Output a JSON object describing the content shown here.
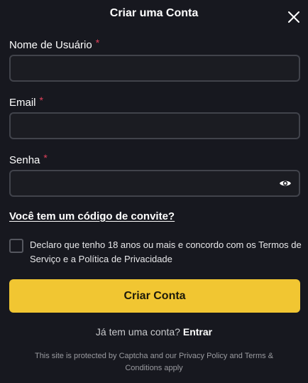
{
  "modal": {
    "title": "Criar uma Conta",
    "close_icon": "close-icon"
  },
  "fields": {
    "username": {
      "label": "Nome de Usuário",
      "required_mark": "*",
      "value": "",
      "placeholder": ""
    },
    "email": {
      "label": "Email",
      "required_mark": "*",
      "value": "",
      "placeholder": ""
    },
    "password": {
      "label": "Senha",
      "required_mark": "*",
      "value": "",
      "placeholder": "",
      "toggle_icon": "eye-icon"
    }
  },
  "invite": {
    "link_text": "Você tem um código de convite?"
  },
  "terms": {
    "checked": false,
    "text": "Declaro que tenho 18 anos ou mais e concordo com os Termos de Serviço e a Política de Privacidade"
  },
  "submit": {
    "label": "Criar Conta"
  },
  "login": {
    "prompt": "Já tem uma conta?",
    "link_text": "Entrar"
  },
  "footer": {
    "captcha_note": "This site is protected by Captcha and our Privacy Policy and Terms & Conditions apply"
  },
  "colors": {
    "background": "#17181f",
    "input_border": "#41434b",
    "accent_button": "#f1c632",
    "required": "#e0405a"
  }
}
